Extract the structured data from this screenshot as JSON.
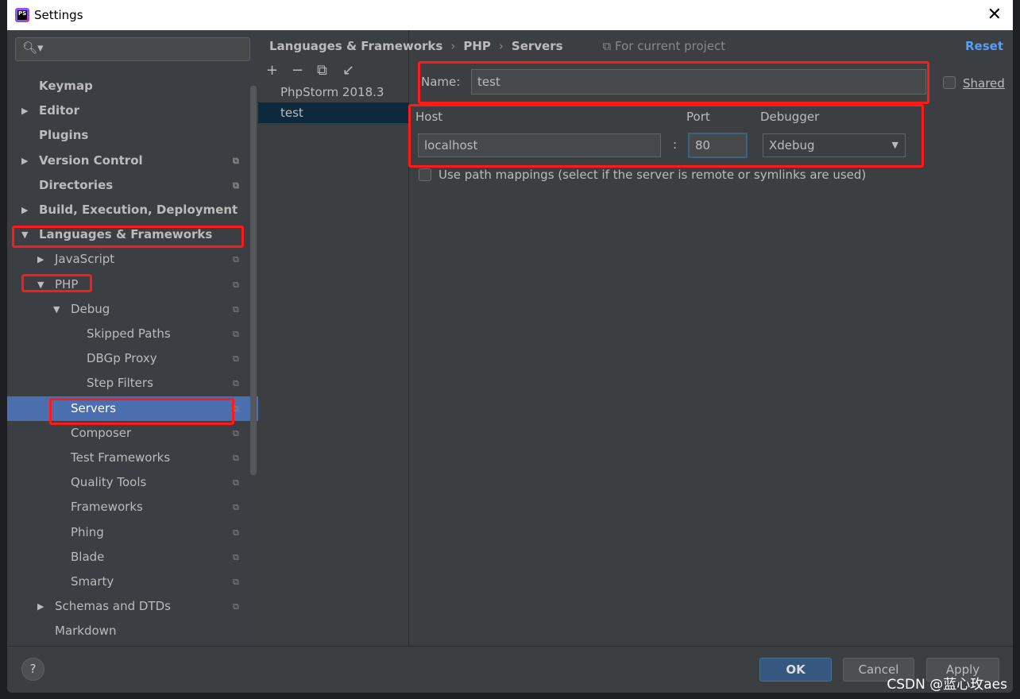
{
  "window": {
    "title": "Settings",
    "close": "✕"
  },
  "sidebar": {
    "search_placeholder": "",
    "items": [
      {
        "label": "Keymap",
        "level": 0,
        "bold": true,
        "arrow": "",
        "proj": false
      },
      {
        "label": "Editor",
        "level": 0,
        "bold": true,
        "arrow": "▶",
        "proj": false
      },
      {
        "label": "Plugins",
        "level": 0,
        "bold": true,
        "arrow": "",
        "proj": false
      },
      {
        "label": "Version Control",
        "level": 0,
        "bold": true,
        "arrow": "▶",
        "proj": true
      },
      {
        "label": "Directories",
        "level": 0,
        "bold": true,
        "arrow": "",
        "proj": true
      },
      {
        "label": "Build, Execution, Deployment",
        "level": 0,
        "bold": true,
        "arrow": "▶",
        "proj": false
      },
      {
        "label": "Languages & Frameworks",
        "level": 0,
        "bold": true,
        "arrow": "▼",
        "proj": false
      },
      {
        "label": "JavaScript",
        "level": 1,
        "arrow": "▶",
        "proj": true
      },
      {
        "label": "PHP",
        "level": 1,
        "arrow": "▼",
        "proj": true
      },
      {
        "label": "Debug",
        "level": 2,
        "arrow": "▼",
        "proj": true
      },
      {
        "label": "Skipped Paths",
        "level": 3,
        "arrow": "",
        "proj": true
      },
      {
        "label": "DBGp Proxy",
        "level": 3,
        "arrow": "",
        "proj": true
      },
      {
        "label": "Step Filters",
        "level": 3,
        "arrow": "",
        "proj": true
      },
      {
        "label": "Servers",
        "level": 2,
        "arrow": "",
        "proj": true,
        "selected": true
      },
      {
        "label": "Composer",
        "level": 2,
        "arrow": "",
        "proj": true
      },
      {
        "label": "Test Frameworks",
        "level": 2,
        "arrow": "",
        "proj": true
      },
      {
        "label": "Quality Tools",
        "level": 2,
        "arrow": "",
        "proj": true
      },
      {
        "label": "Frameworks",
        "level": 2,
        "arrow": "",
        "proj": true
      },
      {
        "label": "Phing",
        "level": 2,
        "arrow": "",
        "proj": true
      },
      {
        "label": "Blade",
        "level": 2,
        "arrow": "",
        "proj": true
      },
      {
        "label": "Smarty",
        "level": 2,
        "arrow": "",
        "proj": true
      },
      {
        "label": "Schemas and DTDs",
        "level": 1,
        "arrow": "▶",
        "proj": true
      },
      {
        "label": "Markdown",
        "level": 1,
        "arrow": "",
        "proj": false
      }
    ]
  },
  "breadcrumb": {
    "items": [
      "Languages & Frameworks",
      "PHP",
      "Servers"
    ],
    "sep": "›",
    "scope": "For current project"
  },
  "reset": "Reset",
  "servers": {
    "toolbar": [
      "+",
      "−",
      "⧉",
      "↙"
    ],
    "items": [
      "PhpStorm 2018.3",
      "test"
    ],
    "selected": 1
  },
  "form": {
    "name_label": "Name:",
    "name_value": "test",
    "shared_label": "Shared",
    "host_label": "Host",
    "host_value": "localhost",
    "colon": ":",
    "port_label": "Port",
    "port_value": "80",
    "debugger_label": "Debugger",
    "debugger_value": "Xdebug",
    "path_mappings_label": "Use path mappings (select if the server is remote or symlinks are used)"
  },
  "footer": {
    "help": "?",
    "ok": "OK",
    "cancel": "Cancel",
    "apply": "Apply"
  },
  "watermark": "CSDN @蓝心玫aes",
  "colors": {
    "selection": "#4b6eaf",
    "accent": "#589df6",
    "highlight": "#ff1a1a"
  }
}
